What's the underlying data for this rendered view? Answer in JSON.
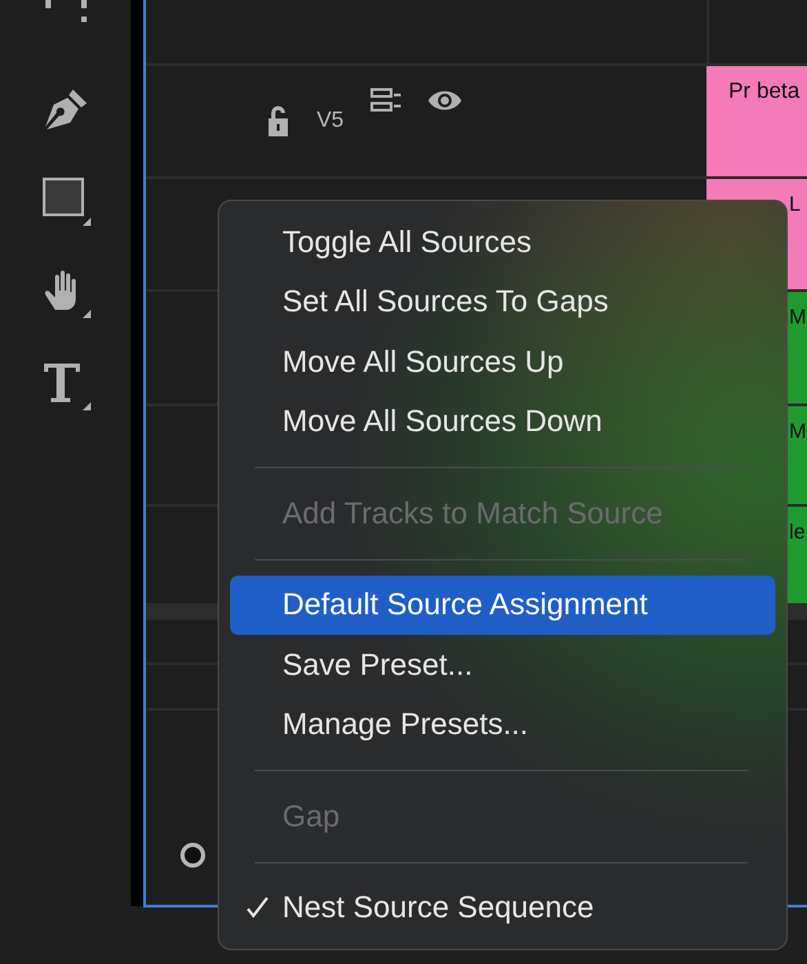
{
  "track_header": {
    "label": "V5"
  },
  "clips": [
    {
      "label": "Pr beta",
      "color": "#f47ab8"
    },
    {
      "label": "L",
      "color": "#f47ab8"
    },
    {
      "label": "M",
      "color": "#1f9a2e"
    },
    {
      "label": "M",
      "color": "#1f9a2e"
    },
    {
      "label": "le",
      "color": "#1f9a2e"
    }
  ],
  "menu": {
    "items": [
      {
        "kind": "item",
        "label": "Toggle All Sources",
        "disabled": false,
        "selected": false,
        "checked": false
      },
      {
        "kind": "item",
        "label": "Set All Sources To Gaps",
        "disabled": false,
        "selected": false,
        "checked": false
      },
      {
        "kind": "item",
        "label": "Move All Sources Up",
        "disabled": false,
        "selected": false,
        "checked": false
      },
      {
        "kind": "item",
        "label": "Move All Sources Down",
        "disabled": false,
        "selected": false,
        "checked": false
      },
      {
        "kind": "separator"
      },
      {
        "kind": "item",
        "label": "Add Tracks to Match Source",
        "disabled": true,
        "selected": false,
        "checked": false
      },
      {
        "kind": "separator"
      },
      {
        "kind": "item",
        "label": "Default Source Assignment",
        "disabled": false,
        "selected": true,
        "checked": false
      },
      {
        "kind": "item",
        "label": "Save Preset...",
        "disabled": false,
        "selected": false,
        "checked": false
      },
      {
        "kind": "item",
        "label": "Manage Presets...",
        "disabled": false,
        "selected": false,
        "checked": false
      },
      {
        "kind": "separator"
      },
      {
        "kind": "item",
        "label": "Gap",
        "disabled": true,
        "selected": false,
        "checked": false
      },
      {
        "kind": "separator"
      },
      {
        "kind": "item",
        "label": "Nest Source Sequence",
        "disabled": false,
        "selected": false,
        "checked": true
      }
    ]
  }
}
